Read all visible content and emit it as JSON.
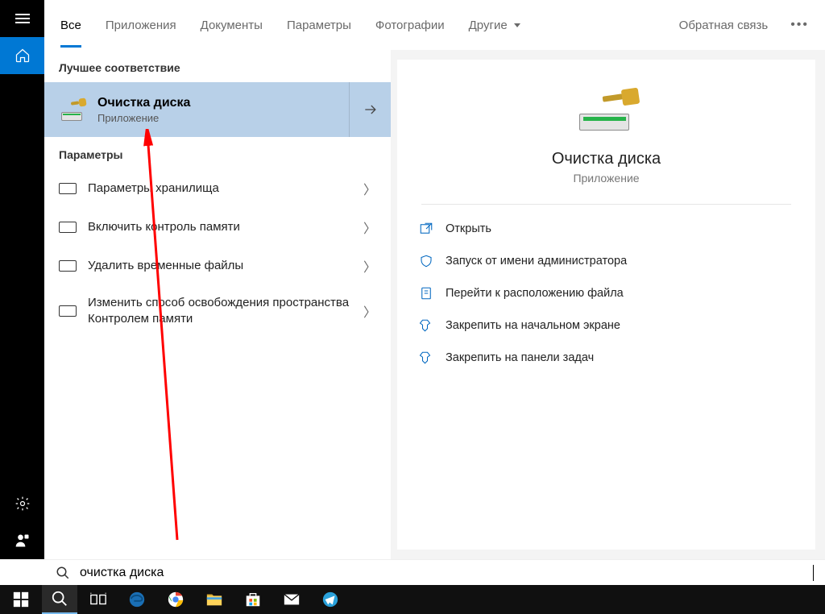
{
  "tabs": {
    "items": [
      "Все",
      "Приложения",
      "Документы",
      "Параметры",
      "Фотографии"
    ],
    "more_label": "Другие",
    "feedback": "Обратная связь"
  },
  "results": {
    "best_header": "Лучшее соответствие",
    "best_match": {
      "title": "Очистка диска",
      "subtitle": "Приложение"
    },
    "settings_header": "Параметры",
    "settings": [
      "Параметры хранилища",
      "Включить контроль памяти",
      "Удалить временные файлы",
      "Изменить способ освобождения пространства Контролем памяти"
    ]
  },
  "preview": {
    "title": "Очистка диска",
    "subtitle": "Приложение",
    "actions": [
      "Открыть",
      "Запуск от имени администратора",
      "Перейти к расположению файла",
      "Закрепить на начальном экране",
      "Закрепить на панели задач"
    ]
  },
  "search": {
    "query": "очистка диска"
  }
}
